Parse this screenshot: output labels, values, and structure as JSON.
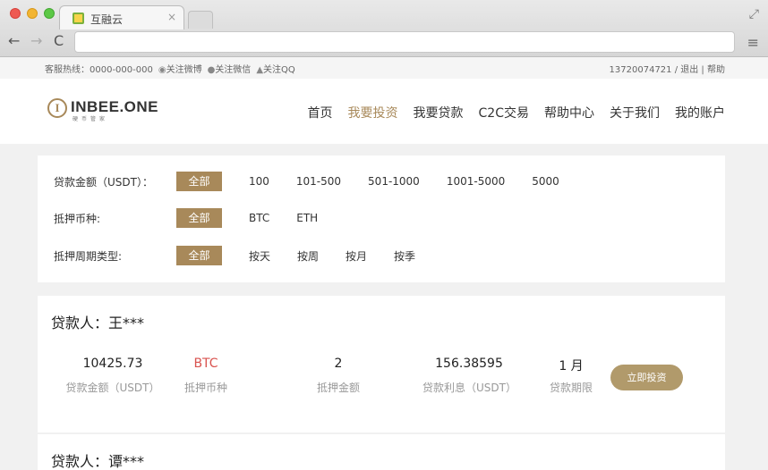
{
  "browser": {
    "tab_title": "互融云",
    "tab_close": "×",
    "back_glyph": "←",
    "forward_glyph": "→",
    "reload_glyph": "C",
    "menu_glyph": "≡",
    "fullscreen_glyph": "⤢"
  },
  "topbar": {
    "hotline": "客服热线：0000-000-000",
    "weibo": "关注微博",
    "wechat": "关注微信",
    "qq": "关注QQ",
    "account": "13720074721 / 退出 | 帮助"
  },
  "logo": {
    "mark": "I",
    "text": "INBEE.ONE",
    "sub": "硬币管家"
  },
  "nav": {
    "items": [
      "首页",
      "我要投资",
      "我要贷款",
      "C2C交易",
      "帮助中心",
      "关于我们",
      "我的账户"
    ],
    "active": "我要投资"
  },
  "filter": {
    "amount_label": "贷款金额（USDT）：",
    "amount_options": [
      "全部",
      "100",
      "101-500",
      "501-1000",
      "1001-5000",
      "5000"
    ],
    "currency_label": "抵押币种:",
    "currency_options": [
      "全部",
      "BTC",
      "ETH"
    ],
    "period_label": "抵押周期类型:",
    "period_options": [
      "全部",
      "按天",
      "按周",
      "按月",
      "按季"
    ]
  },
  "loans": [
    {
      "borrower": "贷款人：王***",
      "amount": "10425.73",
      "amount_label": "贷款金额（USDT）",
      "currency": "BTC",
      "currency_label": "抵押币种",
      "collateral": "2",
      "collateral_label": "抵押金额",
      "interest": "156.38595",
      "interest_label": "贷款利息（USDT）",
      "term": "1 月",
      "term_label": "贷款期限",
      "button": "立即投资"
    },
    {
      "borrower": "贷款人：谭***"
    }
  ],
  "colors": {
    "accent": "#a8895a",
    "button": "#b19a6b",
    "currency_red": "#d9534f"
  }
}
